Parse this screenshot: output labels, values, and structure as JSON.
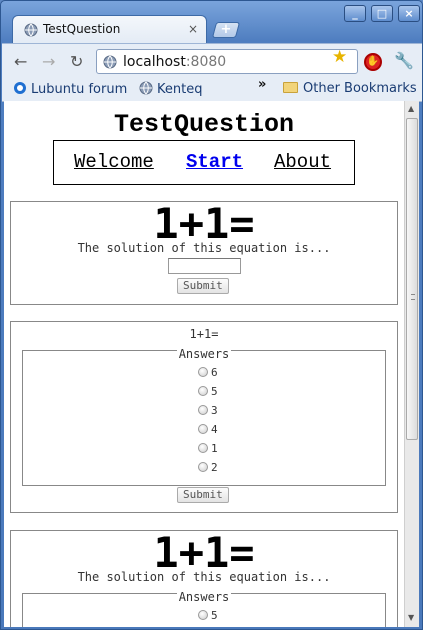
{
  "browser": {
    "tab_title": "TestQuestion",
    "tab_close": "×",
    "newtab_label": "+",
    "window_controls": [
      "_",
      "□",
      "×"
    ],
    "back_glyph": "←",
    "forward_glyph": "→",
    "reload_glyph": "↻",
    "url_host": "localhost",
    "url_port": ":8080",
    "bookmarks": [
      "Lubuntu forum",
      "Kenteq"
    ],
    "bookmarks_overflow": "»",
    "other_bookmarks": "Other Bookmarks",
    "star_glyph": "★",
    "adblock_glyph": "✋",
    "wrench_glyph": "🔧"
  },
  "page": {
    "site_title": "TestQuestion",
    "menu": [
      {
        "label": "Welcome",
        "active": false
      },
      {
        "label": "Start",
        "active": true
      },
      {
        "label": "About",
        "active": false
      }
    ]
  },
  "question1": {
    "equation": "1+1=",
    "prompt": "The solution of this equation is...",
    "input_value": "",
    "submit_label": "Submit"
  },
  "question2": {
    "equation": "1+1=",
    "answers_legend": "Answers",
    "options": [
      "6",
      "5",
      "3",
      "4",
      "1",
      "2"
    ],
    "submit_label": "Submit"
  },
  "question3": {
    "equation": "1+1=",
    "prompt": "The solution of this equation is...",
    "answers_legend": "Answers",
    "options": [
      "5"
    ]
  },
  "colors": {
    "link": "#0000ee",
    "frame": "#4f7ec0"
  }
}
